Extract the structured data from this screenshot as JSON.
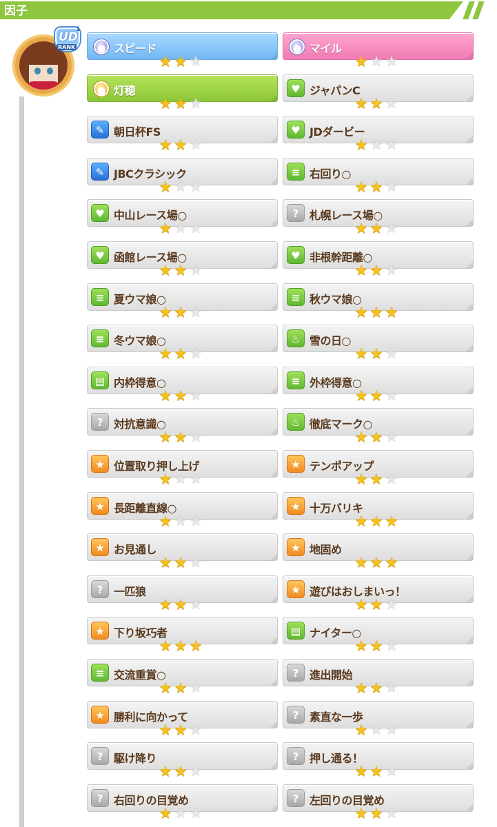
{
  "header": {
    "title": "因子"
  },
  "rank": {
    "letters": "UD",
    "small": "1",
    "text": "RANK"
  },
  "factors": [
    {
      "label": "スピード",
      "stars": 2,
      "style": "blue",
      "icon": "purple-orb-icon",
      "glyph": "●"
    },
    {
      "label": "マイル",
      "stars": 1,
      "style": "pink",
      "icon": "purple-orb-icon",
      "glyph": "●"
    },
    {
      "label": "灯穂",
      "stars": 2,
      "style": "green",
      "icon": "gold-orb-icon",
      "glyph": "●"
    },
    {
      "label": "ジャパンC",
      "stars": 2,
      "style": "plain",
      "icon": "heart-icon",
      "glyph": "♥",
      "iconColor": "green"
    },
    {
      "label": "朝日杯FS",
      "stars": 2,
      "style": "plain",
      "icon": "skill-blue-icon",
      "glyph": "✎",
      "iconColor": "blue"
    },
    {
      "label": "JDダービー",
      "stars": 1,
      "style": "plain",
      "icon": "heart-icon",
      "glyph": "♥",
      "iconColor": "green"
    },
    {
      "label": "JBCクラシック",
      "stars": 1,
      "style": "plain",
      "icon": "skill-blue-icon",
      "glyph": "✎",
      "iconColor": "blue"
    },
    {
      "label": "右回り○",
      "stars": 2,
      "style": "plain",
      "icon": "track-icon",
      "glyph": "≡",
      "iconColor": "green"
    },
    {
      "label": "中山レース場○",
      "stars": 1,
      "style": "plain",
      "icon": "heart-icon",
      "glyph": "♥",
      "iconColor": "green"
    },
    {
      "label": "札幌レース場○",
      "stars": 2,
      "style": "plain",
      "icon": "question-icon",
      "glyph": "?",
      "iconColor": "gray"
    },
    {
      "label": "函館レース場○",
      "stars": 2,
      "style": "plain",
      "icon": "heart-icon",
      "glyph": "♥",
      "iconColor": "green"
    },
    {
      "label": "非根幹距離○",
      "stars": 2,
      "style": "plain",
      "icon": "heart-icon",
      "glyph": "♥",
      "iconColor": "green"
    },
    {
      "label": "夏ウマ娘○",
      "stars": 2,
      "style": "plain",
      "icon": "track-icon",
      "glyph": "≡",
      "iconColor": "green"
    },
    {
      "label": "秋ウマ娘○",
      "stars": 3,
      "style": "plain",
      "icon": "track-icon",
      "glyph": "≡",
      "iconColor": "green"
    },
    {
      "label": "冬ウマ娘○",
      "stars": 2,
      "style": "plain",
      "icon": "track-icon",
      "glyph": "≡",
      "iconColor": "green"
    },
    {
      "label": "雪の日○",
      "stars": 2,
      "style": "plain",
      "icon": "flame-icon",
      "glyph": "♨",
      "iconColor": "green"
    },
    {
      "label": "内枠得意○",
      "stars": 2,
      "style": "plain",
      "icon": "gate-icon",
      "glyph": "▤",
      "iconColor": "green"
    },
    {
      "label": "外枠得意○",
      "stars": 2,
      "style": "plain",
      "icon": "track-icon",
      "glyph": "≡",
      "iconColor": "green"
    },
    {
      "label": "対抗意識○",
      "stars": 2,
      "style": "plain",
      "icon": "question-icon",
      "glyph": "?",
      "iconColor": "gray"
    },
    {
      "label": "徹底マーク○",
      "stars": 2,
      "style": "plain",
      "icon": "flame-icon",
      "glyph": "♨",
      "iconColor": "green"
    },
    {
      "label": "位置取り押し上げ",
      "stars": 1,
      "style": "plain",
      "icon": "runner-icon",
      "glyph": "★",
      "iconColor": "orange"
    },
    {
      "label": "テンポアップ",
      "stars": 2,
      "style": "plain",
      "icon": "runner-icon",
      "glyph": "★",
      "iconColor": "orange"
    },
    {
      "label": "長距離直線○",
      "stars": 1,
      "style": "plain",
      "icon": "runner-icon",
      "glyph": "★",
      "iconColor": "orange"
    },
    {
      "label": "十万バリキ",
      "stars": 3,
      "style": "plain",
      "icon": "runner-icon",
      "glyph": "★",
      "iconColor": "orange"
    },
    {
      "label": "お見通し",
      "stars": 2,
      "style": "plain",
      "icon": "megaphone-icon",
      "glyph": "★",
      "iconColor": "orange"
    },
    {
      "label": "地固め",
      "stars": 3,
      "style": "plain",
      "icon": "runner-icon",
      "glyph": "★",
      "iconColor": "orange"
    },
    {
      "label": "一匹狼",
      "stars": 2,
      "style": "plain",
      "icon": "question-icon",
      "glyph": "?",
      "iconColor": "gray"
    },
    {
      "label": "遊びはおしまいっ！",
      "stars": 2,
      "style": "plain",
      "icon": "runner-icon",
      "glyph": "★",
      "iconColor": "orange"
    },
    {
      "label": "下り坂巧者",
      "stars": 3,
      "style": "plain",
      "icon": "runner-icon",
      "glyph": "★",
      "iconColor": "orange"
    },
    {
      "label": "ナイター○",
      "stars": 2,
      "style": "plain",
      "icon": "gate-icon",
      "glyph": "▤",
      "iconColor": "green"
    },
    {
      "label": "交流重賞○",
      "stars": 2,
      "style": "plain",
      "icon": "track-icon",
      "glyph": "≡",
      "iconColor": "green"
    },
    {
      "label": "進出開始",
      "stars": 2,
      "style": "plain",
      "icon": "question-icon",
      "glyph": "?",
      "iconColor": "gray"
    },
    {
      "label": "勝利に向かって",
      "stars": 2,
      "style": "plain",
      "icon": "runner-icon",
      "glyph": "★",
      "iconColor": "orange"
    },
    {
      "label": "素直な一歩",
      "stars": 1,
      "style": "plain",
      "icon": "question-icon",
      "glyph": "?",
      "iconColor": "gray"
    },
    {
      "label": "駆け降り",
      "stars": 2,
      "style": "plain",
      "icon": "question-icon",
      "glyph": "?",
      "iconColor": "gray"
    },
    {
      "label": "押し通る！",
      "stars": 2,
      "style": "plain",
      "icon": "question-icon",
      "glyph": "?",
      "iconColor": "gray"
    },
    {
      "label": "右回りの目覚め",
      "stars": 1,
      "style": "plain",
      "icon": "question-icon",
      "glyph": "?",
      "iconColor": "gray"
    },
    {
      "label": "左回りの目覚め",
      "stars": 2,
      "style": "plain",
      "icon": "question-icon",
      "glyph": "?",
      "iconColor": "gray"
    }
  ]
}
